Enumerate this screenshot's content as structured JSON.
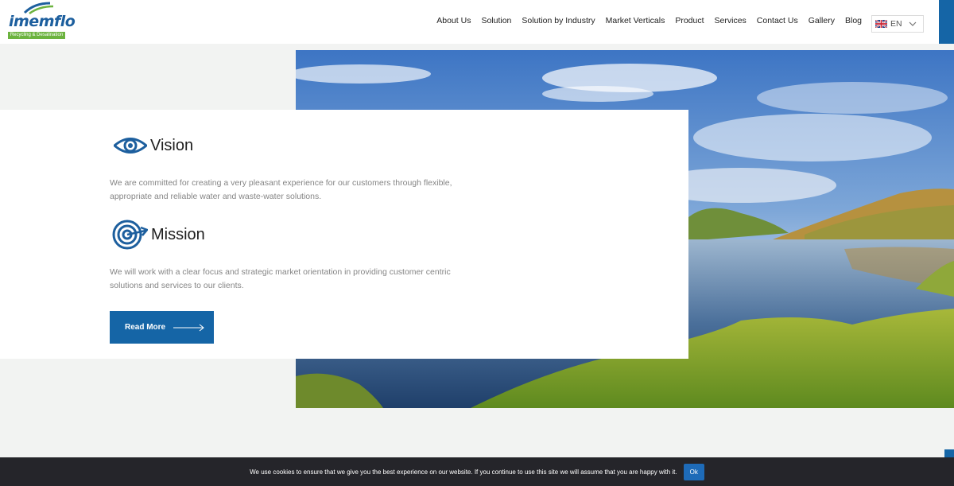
{
  "brand": {
    "name": "imemflo",
    "tagline": "Recycling & Desalination",
    "accent_color": "#1565a6",
    "tag_color": "#6cb33f"
  },
  "nav": {
    "items": [
      "About Us",
      "Solution",
      "Solution by Industry",
      "Market Verticals",
      "Product",
      "Services",
      "Contact Us",
      "Gallery",
      "Blog"
    ]
  },
  "language": {
    "selected": "EN",
    "flag": "uk-flag-icon"
  },
  "hero": {
    "image": "lake-landscape"
  },
  "vision": {
    "icon": "eye-icon",
    "title": "Vision",
    "text": "We are committed for creating a very pleasant experience for our customers through flexible, appropriate and reliable water and waste-water solutions."
  },
  "mission": {
    "icon": "target-icon",
    "title": "Mission",
    "text": "We will work with a clear focus and strategic market orientation in providing customer centric solutions and services to our clients."
  },
  "cta": {
    "read_more": "Read More",
    "icon": "arrow-right-icon"
  },
  "cookie": {
    "text": "We use cookies to ensure that we give you the best experience on our website. If you continue to use this site we will assume that you are happy with it.",
    "ok": "Ok"
  }
}
